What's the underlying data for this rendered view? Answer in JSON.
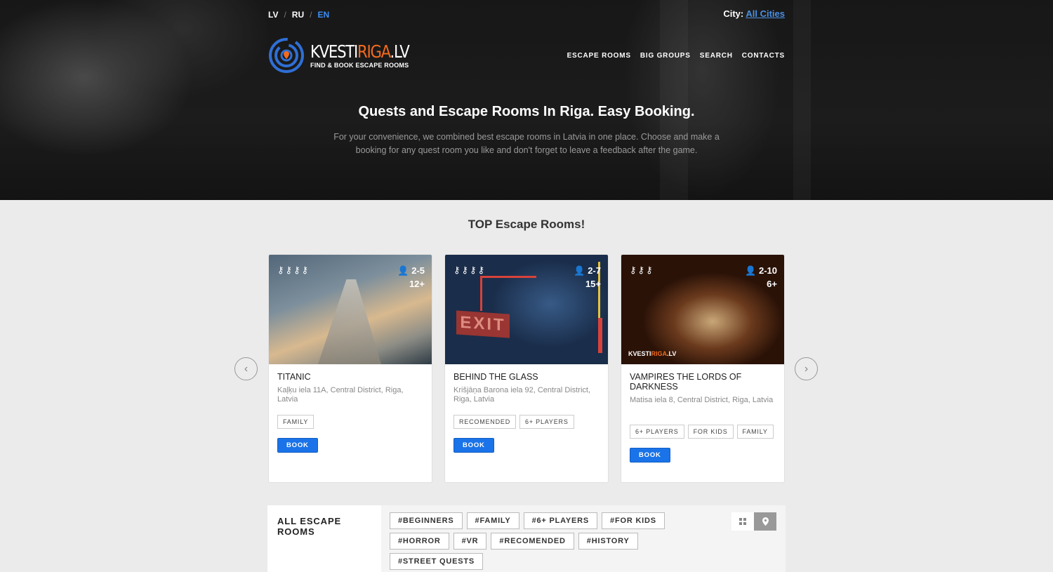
{
  "languages": [
    {
      "code": "LV",
      "active": false
    },
    {
      "code": "RU",
      "active": false
    },
    {
      "code": "EN",
      "active": true
    }
  ],
  "city": {
    "label": "City:",
    "value": "All Cities"
  },
  "logo": {
    "title_main": "KVESTI",
    "title_accent": "RIGA",
    "title_suffix": ".LV",
    "subtitle": "FIND & BOOK ESCAPE ROOMS"
  },
  "nav": [
    "ESCAPE ROOMS",
    "BIG GROUPS",
    "SEARCH",
    "CONTACTS"
  ],
  "hero": {
    "title": "Quests and Escape Rooms In Riga. Easy Booking.",
    "description": "For your convenience, we combined best escape rooms in Latvia in one place. Choose and make a booking for any quest room you like and don't forget to leave a feedback after the game."
  },
  "top_heading": "TOP Escape Rooms!",
  "cards": [
    {
      "title": "TITANIC",
      "address": "Kaļķu iela 11A, Central District, Riga, Latvia",
      "players": "2-5",
      "age": "12+",
      "difficulty": 4,
      "tags": [
        "FAMILY"
      ],
      "book": "BOOK"
    },
    {
      "title": "BEHIND THE GLASS",
      "address": "Krišjāņa Barona iela 92, Central District, Riga, Latvia",
      "players": "2-7",
      "age": "15+",
      "difficulty": 4,
      "tags": [
        "RECOMENDED",
        "6+ PLAYERS"
      ],
      "book": "BOOK",
      "sign": "EXIT"
    },
    {
      "title": "VAMPIRES THE LORDS OF DARKNESS",
      "address": "Matisa iela 8, Central District, Riga, Latvia",
      "players": "2-10",
      "age": "6+",
      "difficulty": 3,
      "tags": [
        "6+ PLAYERS",
        "FOR KIDS",
        "FAMILY"
      ],
      "book": "BOOK"
    }
  ],
  "all_rooms": {
    "title": "ALL ESCAPE ROOMS",
    "filters": [
      "#BEGINNERS",
      "#FAMILY",
      "#6+ PLAYERS",
      "#FOR KIDS",
      "#HORROR",
      "#VR",
      "#RECOMENDED",
      "#HISTORY",
      "#STREET QUESTS"
    ]
  },
  "colors": {
    "accent_blue": "#1a73e8",
    "logo_orange": "#f26b1f",
    "link_blue": "#4a90e2"
  }
}
